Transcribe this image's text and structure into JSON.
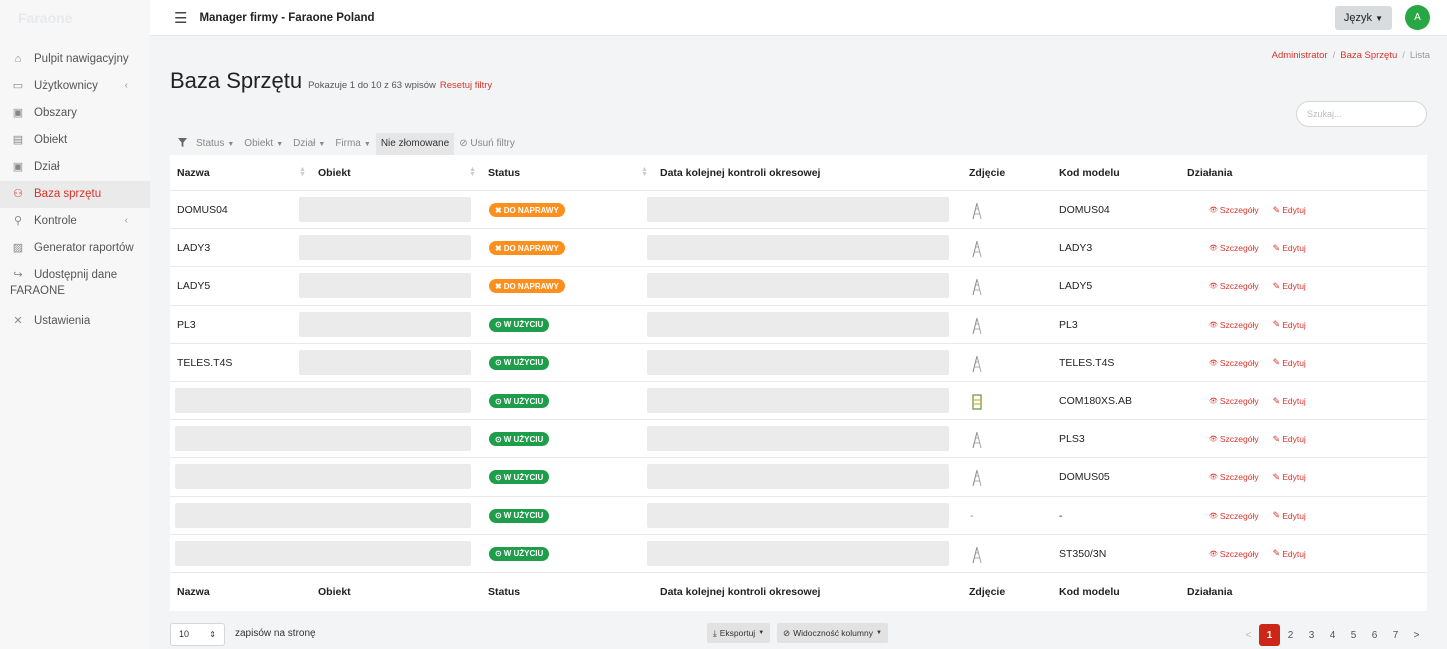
{
  "app": {
    "brand": "Faraone",
    "topbar_title": "Manager firmy - Faraone Poland",
    "language_label": "Język",
    "avatar_initial": "A"
  },
  "sidebar": {
    "items": [
      {
        "label": "Pulpit nawigacyjny",
        "icon": "home-icon"
      },
      {
        "label": "Użytkownicy",
        "icon": "users-icon",
        "caret": "‹"
      },
      {
        "label": "Obszary",
        "icon": "areas-icon"
      },
      {
        "label": "Obiekt",
        "icon": "object-icon"
      },
      {
        "label": "Dział",
        "icon": "department-icon"
      },
      {
        "label": "Baza sprzętu",
        "icon": "equipment-icon",
        "active": true
      },
      {
        "label": "Kontrole",
        "icon": "wrench-icon",
        "caret": "‹"
      },
      {
        "label": "Generator raportów",
        "icon": "report-icon"
      },
      {
        "label": "Udostępnij dane",
        "label2": "FARAONE",
        "icon": "share-icon"
      },
      {
        "label": "Ustawienia",
        "icon": "tools-icon"
      }
    ]
  },
  "breadcrumb": {
    "item1": "Administrator",
    "item2": "Baza Sprzętu",
    "item3": "Lista"
  },
  "heading": {
    "title": "Baza Sprzętu",
    "info": "Pokazuje 1 do 10 z 63 wpisów",
    "reset": "Resetuj filtry"
  },
  "search": {
    "placeholder": "Szukaj..."
  },
  "filters": {
    "status": "Status",
    "object": "Obiekt",
    "department": "Dział",
    "company": "Firma",
    "not_scrapped": "Nie złomowane",
    "clear": "Usuń filtry"
  },
  "table": {
    "columns": {
      "name": "Nazwa",
      "object": "Obiekt",
      "status": "Status",
      "next_check": "Data kolejnej kontroli okresowej",
      "photo": "Zdjęcie",
      "model": "Kod modelu",
      "actions": "Działania"
    },
    "status_labels": {
      "repair": "DO NAPRAWY",
      "in_use": "W UŻYCIU"
    },
    "action_labels": {
      "details": "Szczegóły",
      "edit": "Edytuj"
    },
    "rows": [
      {
        "name": "DOMUS04",
        "status": "repair",
        "model": "DOMUS04",
        "photo": "ladder"
      },
      {
        "name": "LADY3",
        "status": "repair",
        "model": "LADY3",
        "photo": "ladder"
      },
      {
        "name": "LADY5",
        "status": "repair",
        "model": "LADY5",
        "photo": "ladder"
      },
      {
        "name": "PL3",
        "status": "in_use",
        "model": "PL3",
        "photo": "ladder"
      },
      {
        "name": "TELES.T4S",
        "status": "in_use",
        "model": "TELES.T4S",
        "photo": "ladder"
      },
      {
        "name": "",
        "status": "in_use",
        "model": "COM180XS.AB",
        "photo": "scaffold"
      },
      {
        "name": "",
        "status": "in_use",
        "model": "PLS3",
        "photo": "ladder"
      },
      {
        "name": "",
        "status": "in_use",
        "model": "DOMUS05",
        "photo": "ladder"
      },
      {
        "name": "",
        "status": "in_use",
        "model": "-",
        "photo_text": "-"
      },
      {
        "name": "",
        "status": "in_use",
        "model": "ST350/3N",
        "photo": "ladder"
      }
    ]
  },
  "footer": {
    "per_page_value": "10",
    "per_page_label": "zapisów na stronę",
    "export_label": "Eksportuj",
    "columns_visibility_label": "Widoczność kolumny",
    "pages": [
      "1",
      "2",
      "3",
      "4",
      "5",
      "6",
      "7"
    ],
    "prev": "<",
    "next": ">"
  }
}
